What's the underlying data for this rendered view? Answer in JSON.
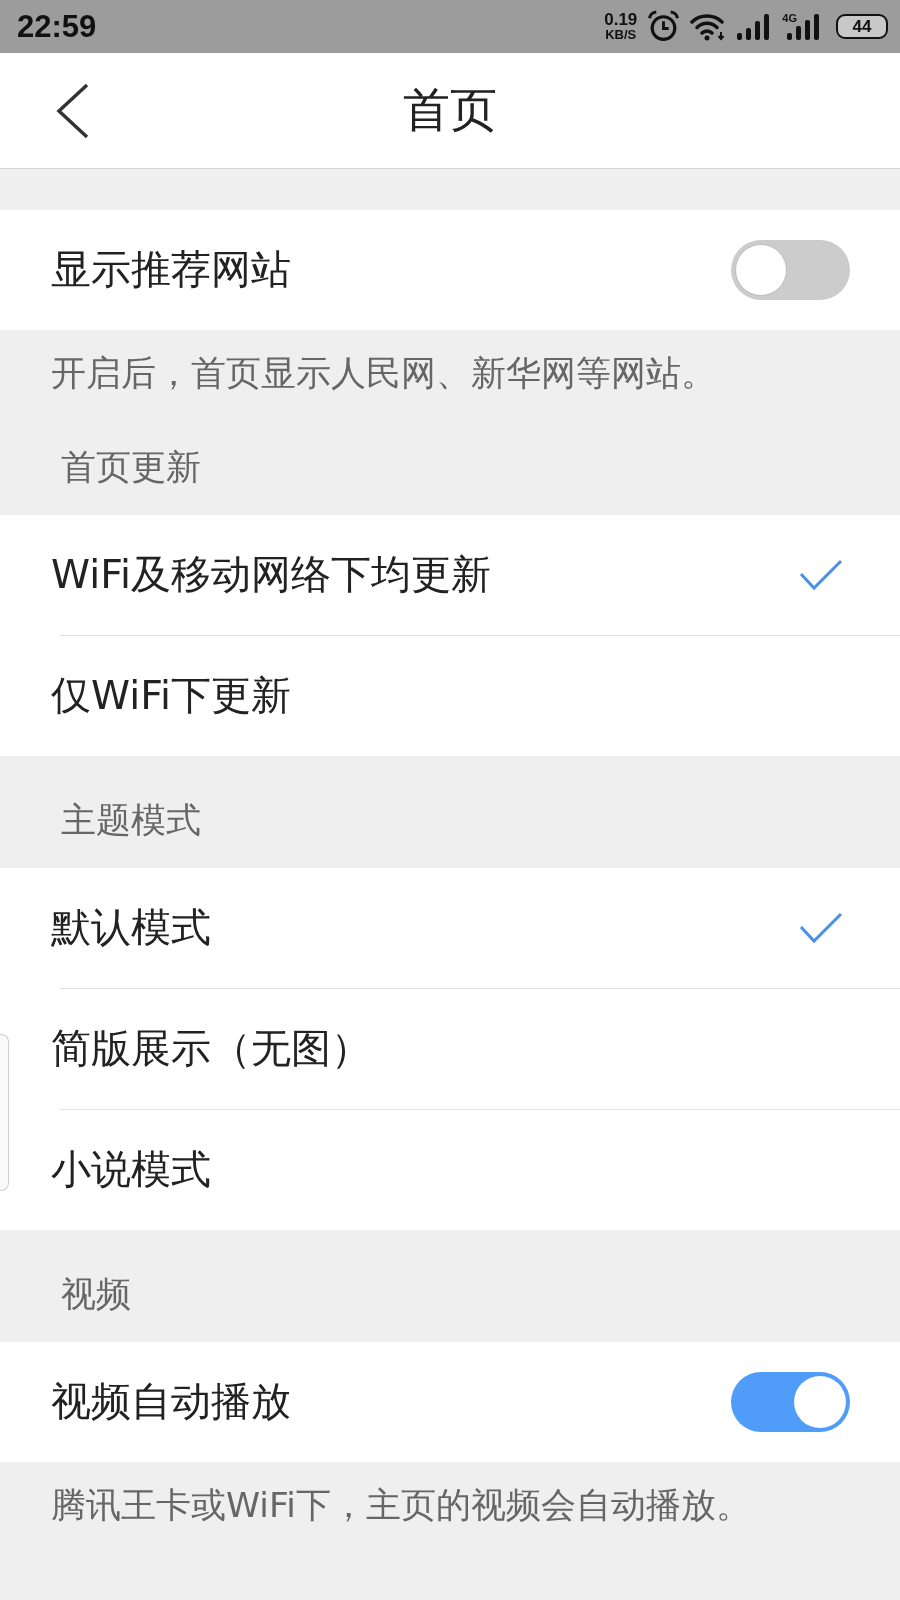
{
  "status_bar": {
    "time": "22:59",
    "net_speed": "0.19",
    "net_speed_unit": "KB/S",
    "network_type": "4G",
    "battery": "44"
  },
  "header": {
    "title": "首页"
  },
  "blocks": [
    {
      "kind": "toggle",
      "label": "显示推荐网站",
      "on": false
    },
    {
      "kind": "note",
      "text": "开启后，首页显示人民网、新华网等网站。"
    },
    {
      "kind": "section",
      "title": "首页更新"
    },
    {
      "kind": "choices",
      "options": [
        {
          "label": "WiFi及移动网络下均更新",
          "selected": true
        },
        {
          "label": "仅WiFi下更新",
          "selected": false
        }
      ]
    },
    {
      "kind": "section",
      "title": "主题模式"
    },
    {
      "kind": "choices",
      "options": [
        {
          "label": "默认模式",
          "selected": true
        },
        {
          "label": "简版展示（无图）",
          "selected": false
        },
        {
          "label": "小说模式",
          "selected": false
        }
      ]
    },
    {
      "kind": "section",
      "title": "视频"
    },
    {
      "kind": "toggle",
      "label": "视频自动播放",
      "on": true
    },
    {
      "kind": "note",
      "text": "腾讯王卡或WiFi下，主页的视频会自动播放。"
    }
  ]
}
